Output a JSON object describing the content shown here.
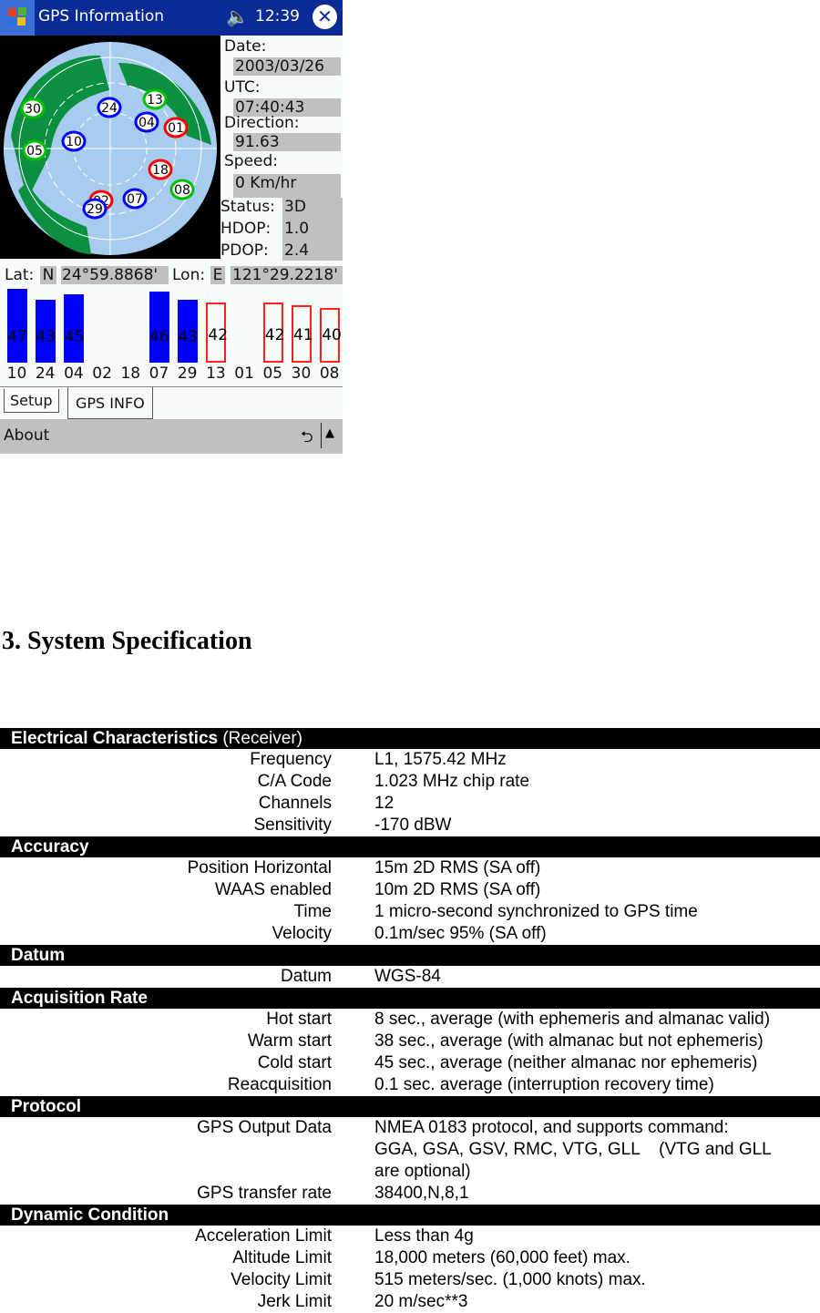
{
  "device": {
    "title": "GPS Information",
    "clock": "12:39",
    "icons": {
      "start": "windows-flag-icon",
      "speaker": "speaker-icon",
      "close": "close-icon"
    }
  },
  "info": {
    "date_label": "Date:",
    "date": "2003/03/26",
    "utc_label": "UTC:",
    "utc": "07:40:43",
    "direction_label": "Direction:",
    "direction": "91.63",
    "speed_label": "Speed:",
    "speed": "0 Km/hr",
    "status_label": "Status:",
    "status": "3D",
    "hdop_label": "HDOP:",
    "hdop": "1.0",
    "pdop_label": "PDOP:",
    "pdop": "2.4"
  },
  "position": {
    "lat_label": "Lat:",
    "lat_hemi": "N",
    "lat": "24°59.8868'",
    "lon_label": "Lon:",
    "lon_hemi": "E",
    "lon": "121°29.2218'"
  },
  "satellites_sky": [
    {
      "prn": "30",
      "color": "#00c000"
    },
    {
      "prn": "05",
      "color": "#00c000"
    },
    {
      "prn": "10",
      "color": "#0000ff"
    },
    {
      "prn": "24",
      "color": "#0000ff"
    },
    {
      "prn": "13",
      "color": "#00c000"
    },
    {
      "prn": "04",
      "color": "#0000ff"
    },
    {
      "prn": "01",
      "color": "#ff0000"
    },
    {
      "prn": "18",
      "color": "#ff0000"
    },
    {
      "prn": "08",
      "color": "#00c000"
    },
    {
      "prn": "07",
      "color": "#0000ff"
    },
    {
      "prn": "29",
      "color": "#0000ff"
    },
    {
      "prn": "02",
      "color": "#ff0000"
    }
  ],
  "signal_bars": [
    {
      "prn": "10",
      "snr": "47",
      "state": "used"
    },
    {
      "prn": "24",
      "snr": "43",
      "state": "used"
    },
    {
      "prn": "04",
      "snr": "45",
      "state": "used"
    },
    {
      "prn": "02",
      "snr": "",
      "state": "none"
    },
    {
      "prn": "18",
      "snr": "",
      "state": "none"
    },
    {
      "prn": "07",
      "snr": "46",
      "state": "used"
    },
    {
      "prn": "29",
      "snr": "43",
      "state": "used"
    },
    {
      "prn": "13",
      "snr": "42",
      "state": "tracked"
    },
    {
      "prn": "01",
      "snr": "",
      "state": "none"
    },
    {
      "prn": "05",
      "snr": "42",
      "state": "tracked"
    },
    {
      "prn": "30",
      "snr": "41",
      "state": "tracked"
    },
    {
      "prn": "08",
      "snr": "40",
      "state": "tracked"
    }
  ],
  "tabs": [
    {
      "label": "Setup"
    },
    {
      "label": "GPS INFO"
    }
  ],
  "menu": {
    "about": "About"
  },
  "doc": {
    "heading": "3. System Specification",
    "sections": [
      {
        "title": "Electrical Characteristics",
        "subtitle": " (Receiver)",
        "rows": [
          {
            "k": "Frequency",
            "v": "L1, 1575.42 MHz"
          },
          {
            "k": "C/A Code",
            "v": "1.023 MHz chip rate"
          },
          {
            "k": "Channels",
            "v": "12"
          },
          {
            "k": "Sensitivity",
            "v": "-170 dBW"
          }
        ]
      },
      {
        "title": "Accuracy",
        "subtitle": "",
        "rows": [
          {
            "k": "Position Horizontal",
            "v": "15m 2D RMS (SA off)"
          },
          {
            "k": "WAAS enabled",
            "v": "10m 2D RMS (SA off)"
          },
          {
            "k": "Time",
            "v": "1 micro-second synchronized to GPS time"
          },
          {
            "k": "Velocity",
            "v": "0.1m/sec 95% (SA off)"
          }
        ]
      },
      {
        "title": "Datum",
        "subtitle": "",
        "rows": [
          {
            "k": "Datum",
            "v": "WGS-84"
          }
        ]
      },
      {
        "title": "Acquisition Rate",
        "subtitle": "",
        "rows": [
          {
            "k": "Hot start",
            "v": "8 sec., average (with ephemeris and almanac valid)"
          },
          {
            "k": "Warm start",
            "v": "38 sec., average (with almanac but not ephemeris)"
          },
          {
            "k": "Cold start",
            "v": "45 sec., average (neither almanac nor ephemeris)"
          },
          {
            "k": "Reacquisition",
            "v": "0.1 sec. average (interruption recovery time)"
          }
        ]
      },
      {
        "title": "Protocol",
        "subtitle": "",
        "rows": [
          {
            "k": "GPS Output Data",
            "v": "NMEA 0183 protocol, and supports command:"
          },
          {
            "k": "",
            "v": "GGA, GSA, GSV, RMC, VTG, GLL    (VTG and GLL"
          },
          {
            "k": "",
            "v": "are optional)"
          },
          {
            "k": "GPS transfer rate",
            "v": "38400,N,8,1"
          }
        ]
      },
      {
        "title": "Dynamic Condition",
        "subtitle": "",
        "rows": [
          {
            "k": "Acceleration Limit",
            "v": "Less than 4g"
          },
          {
            "k": "Altitude Limit",
            "v": "18,000 meters (60,000 feet) max."
          },
          {
            "k": "Velocity Limit",
            "v": "515 meters/sec. (1,000 knots) max."
          },
          {
            "k": "Jerk Limit",
            "v": "20 m/sec**3"
          }
        ]
      }
    ]
  }
}
